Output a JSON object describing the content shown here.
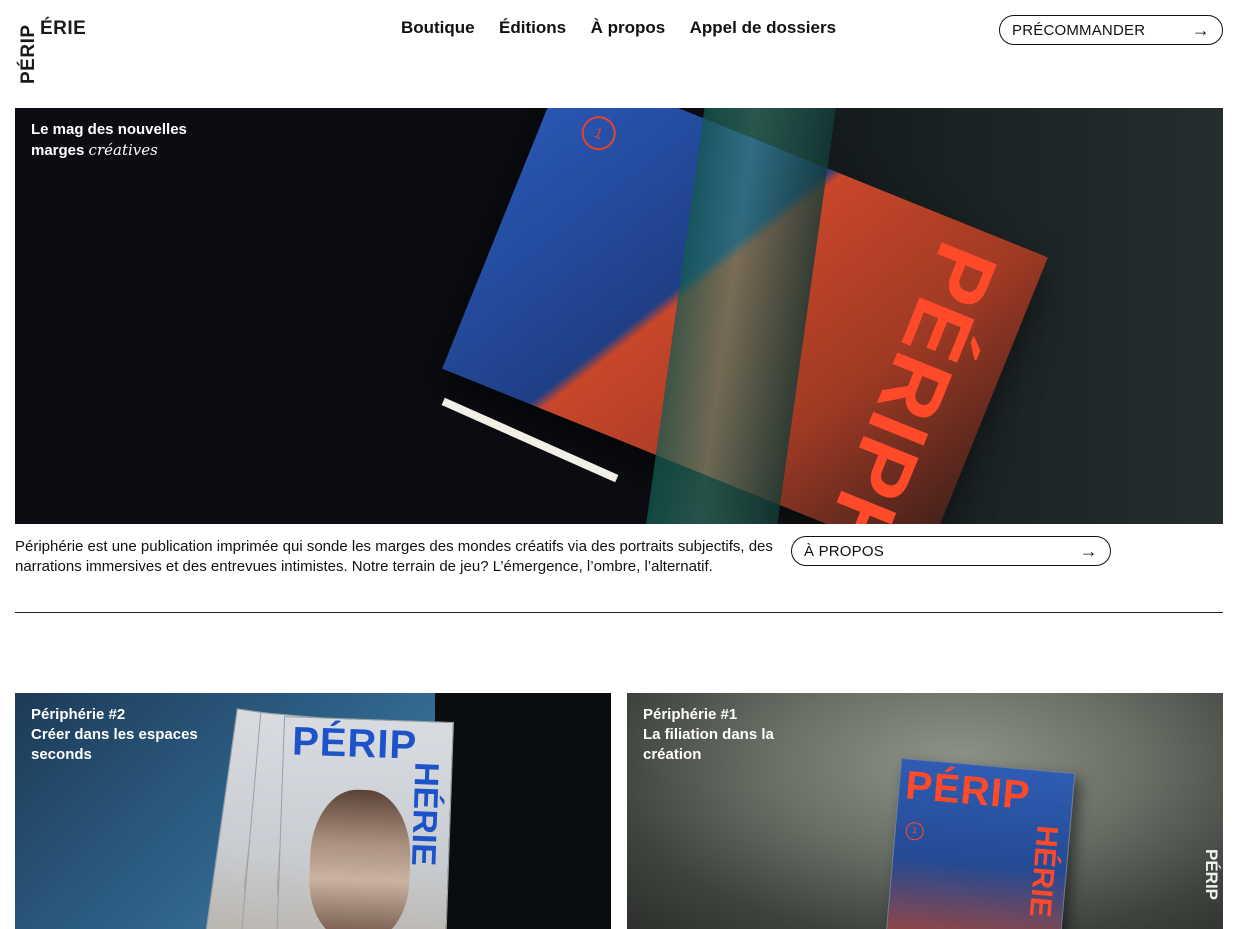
{
  "header": {
    "logo": {
      "horizontal": "ÉRIE",
      "vertical": "PÉRIP"
    },
    "nav": [
      "Boutique",
      "Éditions",
      "À propos",
      "Appel de dossiers"
    ],
    "cta_label": "PRÉCOMMANDER",
    "cta_icon": "arrow-right-icon"
  },
  "hero": {
    "tagline_line1": "Le mag des nouvelles",
    "tagline_line2_prefix": "marges",
    "tagline_line2_script": "créatives",
    "image_title": "PÉRIPHÉRIE",
    "image_issue": "1"
  },
  "about": {
    "text": "Périphérie est une publication imprimée qui sonde les marges des mondes créatifs via des portraits subjectifs, des narrations immersives et des entrevues intimistes. Notre terrain de jeu? L’émergence, l’ombre, l’alternatif.",
    "button_label": "À PROPOS",
    "button_icon": "arrow-right-icon"
  },
  "issues": [
    {
      "number": "Périphérie #2",
      "line1": "Créer dans les espaces",
      "line2": "seconds",
      "cover_title": "PÉRIP",
      "cover_vertical": "HÉRIE"
    },
    {
      "number": "Périphérie #1",
      "line1": "La filiation dans la",
      "line2": "création",
      "cover_title": "PÉRIP",
      "cover_vertical": "HÉRIE",
      "cover_issue": "1"
    }
  ],
  "colors": {
    "text": "#111111",
    "background": "#ffffff",
    "brand_red": "#ff4a2a",
    "brand_blue": "#1c53c9"
  }
}
